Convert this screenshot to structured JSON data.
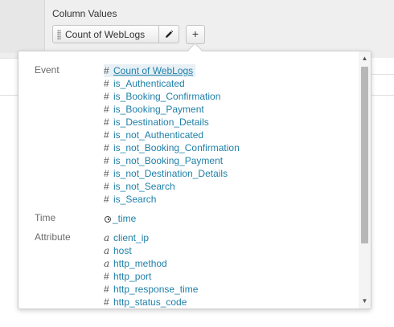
{
  "column_values": {
    "title": "Column Values",
    "field_label": "Count of WebLogs",
    "add_label": "+"
  },
  "field_picker": {
    "groups": [
      {
        "label": "Event",
        "items": [
          {
            "type": "#",
            "name": "Count of WebLogs",
            "selected": true
          },
          {
            "type": "#",
            "name": "is_Authenticated"
          },
          {
            "type": "#",
            "name": "is_Booking_Confirmation"
          },
          {
            "type": "#",
            "name": "is_Booking_Payment"
          },
          {
            "type": "#",
            "name": "is_Destination_Details"
          },
          {
            "type": "#",
            "name": "is_not_Authenticated"
          },
          {
            "type": "#",
            "name": "is_not_Booking_Confirmation"
          },
          {
            "type": "#",
            "name": "is_not_Booking_Payment"
          },
          {
            "type": "#",
            "name": "is_not_Destination_Details"
          },
          {
            "type": "#",
            "name": "is_not_Search"
          },
          {
            "type": "#",
            "name": "is_Search"
          }
        ]
      },
      {
        "label": "Time",
        "items": [
          {
            "type": "clock-icon",
            "name": "_time"
          }
        ]
      },
      {
        "label": "Attribute",
        "items": [
          {
            "type": "a",
            "name": "client_ip"
          },
          {
            "type": "a",
            "name": "host"
          },
          {
            "type": "a",
            "name": "http_method"
          },
          {
            "type": "#",
            "name": "http_port"
          },
          {
            "type": "#",
            "name": "http_response_time"
          },
          {
            "type": "#",
            "name": "http_status_code"
          }
        ]
      }
    ]
  },
  "colors": {
    "link": "#1e7fa8",
    "group_label": "#6b6b6b",
    "selected_bg": "#e8f0f5"
  }
}
